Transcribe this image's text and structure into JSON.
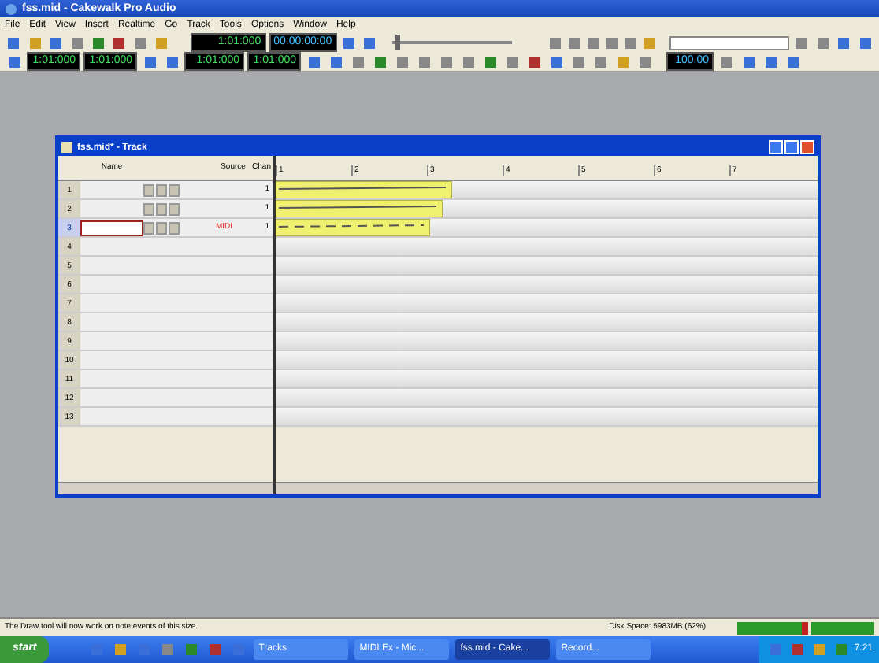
{
  "window": {
    "title": "fss.mid - Cakewalk Pro Audio"
  },
  "menu": [
    "File",
    "Edit",
    "View",
    "Insert",
    "Realtime",
    "Go",
    "Track",
    "Tools",
    "Options",
    "Window",
    "Help"
  ],
  "toolbar": {
    "now_time": "1:01:000",
    "smpte": "00:00:00:00",
    "from": "1:01:000",
    "thru": "1:01:000",
    "loop_start": "1:01:000",
    "loop_end": "1:01:000",
    "tempo": "100.00",
    "position": {
      "level": 0.03
    }
  },
  "track_window": {
    "title": "fss.mid* - Track",
    "columns": [
      "Name",
      "Source",
      "Chan"
    ],
    "ruler": [
      "1",
      "2",
      "3",
      "4",
      "5",
      "6",
      "7"
    ],
    "tracks": [
      {
        "kind": "track",
        "number": "1",
        "chan": "1",
        "selected": false
      },
      {
        "kind": "track",
        "number": "2",
        "chan": "1",
        "selected": false
      },
      {
        "kind": "track",
        "number": "3",
        "source": "MIDI",
        "chan": "1",
        "selected": true
      },
      {
        "kind": "empty",
        "number": "4",
        "selected": false
      },
      {
        "kind": "empty",
        "number": "5",
        "selected": false
      },
      {
        "kind": "empty",
        "number": "6",
        "selected": false
      },
      {
        "kind": "empty",
        "number": "7",
        "selected": false
      },
      {
        "kind": "empty",
        "number": "8",
        "selected": false
      },
      {
        "kind": "empty",
        "number": "9",
        "selected": false
      },
      {
        "kind": "empty",
        "number": "10",
        "selected": false
      },
      {
        "kind": "empty",
        "number": "11",
        "selected": false
      },
      {
        "kind": "empty",
        "number": "12",
        "selected": false
      },
      {
        "kind": "empty",
        "number": "13",
        "selected": false
      }
    ]
  },
  "status_bar": {
    "message": "The Draw tool will now work on note events of this size.",
    "disk_space": "Disk Space: 5983MB (62%)"
  },
  "taskbar": {
    "start": "start",
    "tasks": [
      {
        "label": "Tracks",
        "selected": false
      },
      {
        "label": "MIDI Ex - Mic...",
        "selected": false
      },
      {
        "label": "fss.mid - Cake...",
        "selected": true
      },
      {
        "label": "Record...",
        "selected": false
      }
    ],
    "clock": "7:21"
  }
}
